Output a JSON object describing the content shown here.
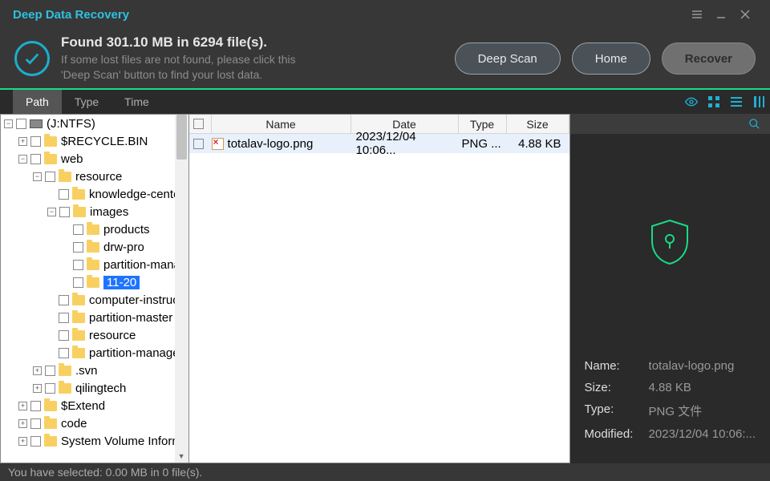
{
  "app": {
    "title": "Deep Data Recovery"
  },
  "header": {
    "title": "Found 301.10 MB in 6294 file(s).",
    "sub1": "If some lost files are not found, please click this",
    "sub2": "'Deep Scan' button to find your lost data.",
    "deep": "Deep Scan",
    "home": "Home",
    "recover": "Recover"
  },
  "tabs": {
    "path": "Path",
    "type": "Type",
    "time": "Time"
  },
  "tree": {
    "root": "(J:NTFS)",
    "n_recycle": "$RECYCLE.BIN",
    "n_web": "web",
    "n_resource": "resource",
    "n_knowledge": "knowledge-center",
    "n_images": "images",
    "n_products": "products",
    "n_drwpro": "drw-pro",
    "n_partmana": "partition-manage",
    "n_1120": "11-20",
    "n_compinstr": "computer-instruction",
    "n_partmaster": "partition-master",
    "n_resource2": "resource",
    "n_partmanager": "partition-manager",
    "n_svn": ".svn",
    "n_qiling": "qilingtech",
    "n_extend": "$Extend",
    "n_code": "code",
    "n_sysvol": "System Volume Information"
  },
  "list": {
    "h_name": "Name",
    "h_date": "Date",
    "h_type": "Type",
    "h_size": "Size",
    "rows": [
      {
        "name": "totalav-logo.png",
        "date": "2023/12/04 10:06...",
        "type": "PNG ...",
        "size": "4.88 KB"
      }
    ]
  },
  "detail": {
    "k_name": "Name:",
    "k_size": "Size:",
    "k_type": "Type:",
    "k_modified": "Modified:",
    "v_name": "totalav-logo.png",
    "v_size": "4.88 KB",
    "v_type": "PNG 文件",
    "v_modified": "2023/12/04 10:06:..."
  },
  "status": "You have selected: 0.00 MB in 0 file(s)."
}
